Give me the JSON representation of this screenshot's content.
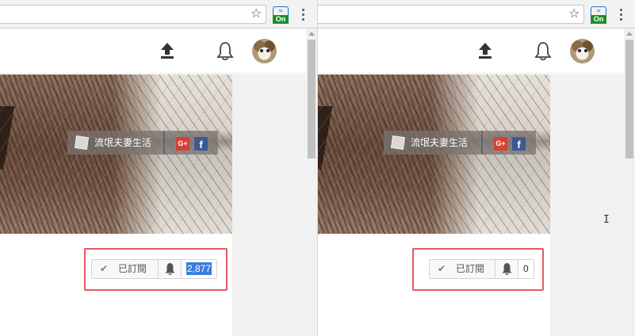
{
  "left": {
    "extension_badge": "On",
    "channel_link": "流氓夫妻生活",
    "gplus_label": "G+",
    "fb_label": "f",
    "subscribe_label": "已訂閱",
    "subscriber_count": "2,877"
  },
  "right": {
    "extension_badge": "On",
    "channel_link": "流氓夫妻生活",
    "gplus_label": "G+",
    "fb_label": "f",
    "subscribe_label": "已訂閱",
    "subscriber_count": "0"
  },
  "colors": {
    "highlight_border": "#e35b63",
    "selection": "#3a7de0",
    "extension_on": "#1e8e2a",
    "gplus": "#d44135",
    "facebook": "#3b5998"
  },
  "icons": [
    "star-icon",
    "extension-icon",
    "menu-icon",
    "upload-icon",
    "bell-icon",
    "check-icon",
    "notification-bell-icon",
    "google-plus-icon",
    "facebook-icon"
  ]
}
